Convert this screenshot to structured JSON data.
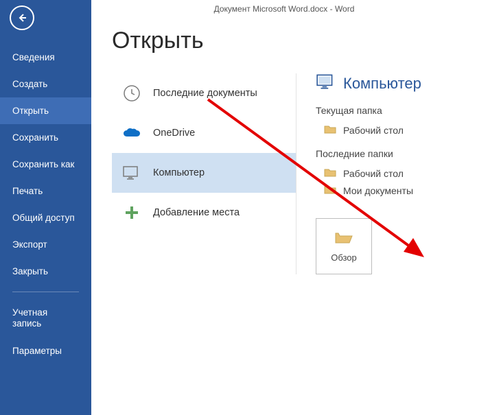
{
  "titleBar": "Документ Microsoft Word.docx - Word",
  "pageTitle": "Открыть",
  "nav": {
    "items": [
      {
        "label": "Сведения"
      },
      {
        "label": "Создать"
      },
      {
        "label": "Открыть"
      },
      {
        "label": "Сохранить"
      },
      {
        "label": "Сохранить как"
      },
      {
        "label": "Печать"
      },
      {
        "label": "Общий доступ"
      },
      {
        "label": "Экспорт"
      },
      {
        "label": "Закрыть"
      }
    ],
    "bottom": [
      {
        "label": "Учетная запись"
      },
      {
        "label": "Параметры"
      }
    ]
  },
  "sources": {
    "recent": "Последние документы",
    "onedrive": "OneDrive",
    "computer": "Компьютер",
    "addplace": "Добавление места"
  },
  "rightPane": {
    "heading": "Компьютер",
    "currentFolderLabel": "Текущая папка",
    "currentFolder": "Рабочий стол",
    "recentFoldersLabel": "Последние папки",
    "recentFolders": [
      "Рабочий стол",
      "Мои документы"
    ],
    "browse": "Обзор"
  }
}
